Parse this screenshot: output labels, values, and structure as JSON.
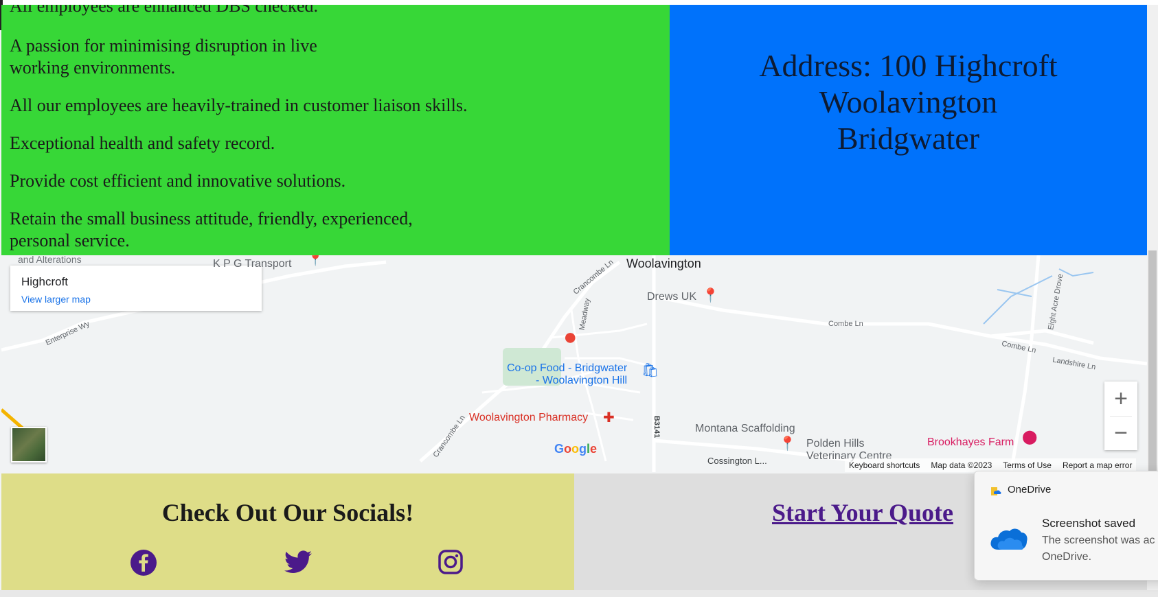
{
  "features": {
    "items": [
      "All employees are enhanced DBS checked.",
      "A passion for minimising disruption in live",
      "working environments.",
      "All our employees are heavily-trained in customer liaison skills.",
      "Exceptional health and safety record.",
      "Provide cost efficient and innovative solutions.",
      "Retain the small business attitude, friendly, experienced,",
      "personal service."
    ]
  },
  "address": {
    "line1": "Address: 100 Highcroft",
    "line2": "Woolavington",
    "line3": "Bridgwater"
  },
  "map": {
    "card_title": "Highcroft",
    "card_link": "View larger map",
    "labels": {
      "partial_top": "and Alterations",
      "kpg": "K P G Transport",
      "woolavington": "Woolavington",
      "drews": "Drews UK",
      "coop1": "Co-op Food - Bridgwater",
      "coop2": "- Woolavington Hill",
      "pharmacy": "Woolavington Pharmacy",
      "montana": "Montana Scaffolding",
      "polden1": "Polden Hills",
      "polden2": "Veterinary Centre",
      "brookhayes": "Brookhayes Farm"
    },
    "roads": {
      "enterprise": "Enterprise Wy",
      "crancombe_top": "Crancombe Ln",
      "crancombe_bottom": "Crancombe Ln",
      "meadway": "Meadway",
      "combe1": "Combe Ln",
      "combe2": "Combe Ln",
      "eight_acre": "Eight Acre Drove",
      "landshire": "Landshire Ln",
      "b3141": "B3141",
      "cossington": "Cossington L..."
    },
    "zoom_in": "+",
    "zoom_out": "−",
    "google": "Google",
    "attribution": [
      "Keyboard shortcuts",
      "Map data ©2023",
      "Terms of Use",
      "Report a map error"
    ],
    "colors": {
      "blue_label": "#1a73e8",
      "pharmacy": "#d93025",
      "farm": "#d81b60",
      "poi": "#70757a"
    }
  },
  "socials": {
    "heading": "Check Out Our Socials!",
    "icons": [
      "facebook-icon",
      "twitter-icon",
      "instagram-icon"
    ]
  },
  "quote": {
    "link": "Start Your Quote"
  },
  "toast": {
    "app": "OneDrive",
    "title": "Screenshot saved",
    "body_line1": "The screenshot was ac",
    "body_line2": "OneDrive."
  }
}
